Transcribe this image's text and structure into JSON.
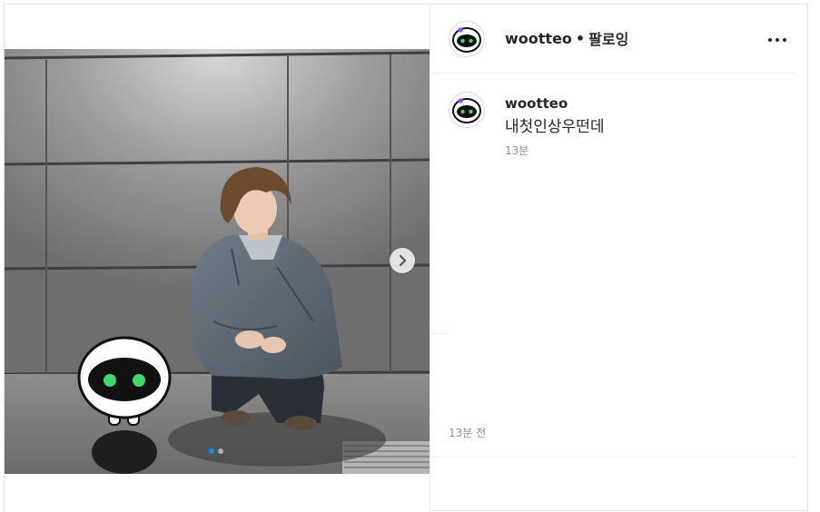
{
  "post": {
    "username": "wootteo",
    "separator": "•",
    "follow_status": "팔로잉",
    "more_label": "더 보기",
    "caption_username": "wootteo",
    "caption_text": "내첫인상우떤데",
    "caption_time": "13분",
    "post_time": "13분 전"
  },
  "carousel": {
    "slide_count": 2,
    "current_slide": 1
  },
  "icons": {
    "avatar": "robot-avatar-icon",
    "next": "chevron-right-icon",
    "more": "more-options-icon"
  },
  "colors": {
    "accent": "#0095f6",
    "robot_eye": "#3dd96a",
    "avatar_badge": "#8a4fff"
  }
}
